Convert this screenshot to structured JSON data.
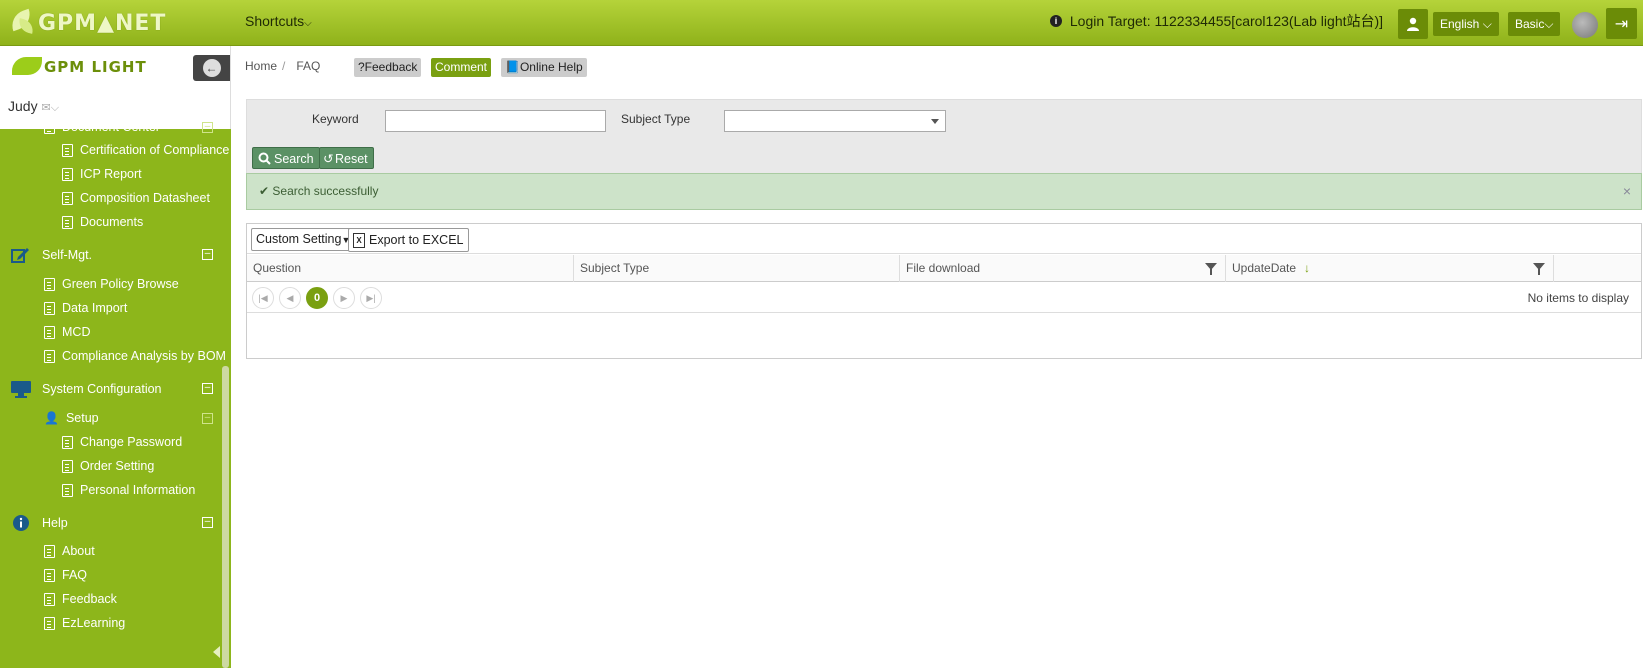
{
  "header": {
    "logo_text": "GPM▲NET",
    "shortcuts": "Shortcuts",
    "login_label": "Login Target:",
    "login_value": "1122334455[carol123(Lab light站台)]",
    "language": "English",
    "mode": "Basic"
  },
  "sidebar": {
    "brand": "GPM LIGHT",
    "user": "Judy",
    "items": [
      {
        "label": "Document Center",
        "level": 1
      },
      {
        "label": "Certification of Compliance",
        "level": 2
      },
      {
        "label": "ICP Report",
        "level": 2
      },
      {
        "label": "Composition Datasheet",
        "level": 2
      },
      {
        "label": "Documents",
        "level": 2
      }
    ],
    "self_mgt": {
      "label": "Self-Mgt.",
      "items": [
        "Green Policy Browse",
        "Data Import",
        "MCD",
        "Compliance Analysis by BOM"
      ]
    },
    "system": {
      "label": "System Configuration",
      "setup": "Setup",
      "items": [
        "Change Password",
        "Order Setting",
        "Personal Information"
      ]
    },
    "help": {
      "label": "Help",
      "items": [
        "About",
        "FAQ",
        "Feedback",
        "EzLearning"
      ]
    }
  },
  "breadcrumb": {
    "home": "Home",
    "sep": "/",
    "current": "FAQ"
  },
  "actions": {
    "feedback": "?Feedback",
    "comment": "Comment",
    "online_help": "Online Help"
  },
  "search": {
    "keyword_label": "Keyword",
    "keyword_value": "",
    "subject_label": "Subject Type",
    "subject_value": "",
    "search_btn": "Search",
    "reset_btn": "Reset"
  },
  "alert": {
    "text": "Search successfully",
    "close": "×"
  },
  "grid": {
    "custom_setting": "Custom Setting",
    "export": "Export to EXCEL",
    "columns": [
      "Question",
      "Subject Type",
      "File download",
      "UpdateDate"
    ],
    "current_page": "0",
    "empty_text": "No items to display"
  }
}
